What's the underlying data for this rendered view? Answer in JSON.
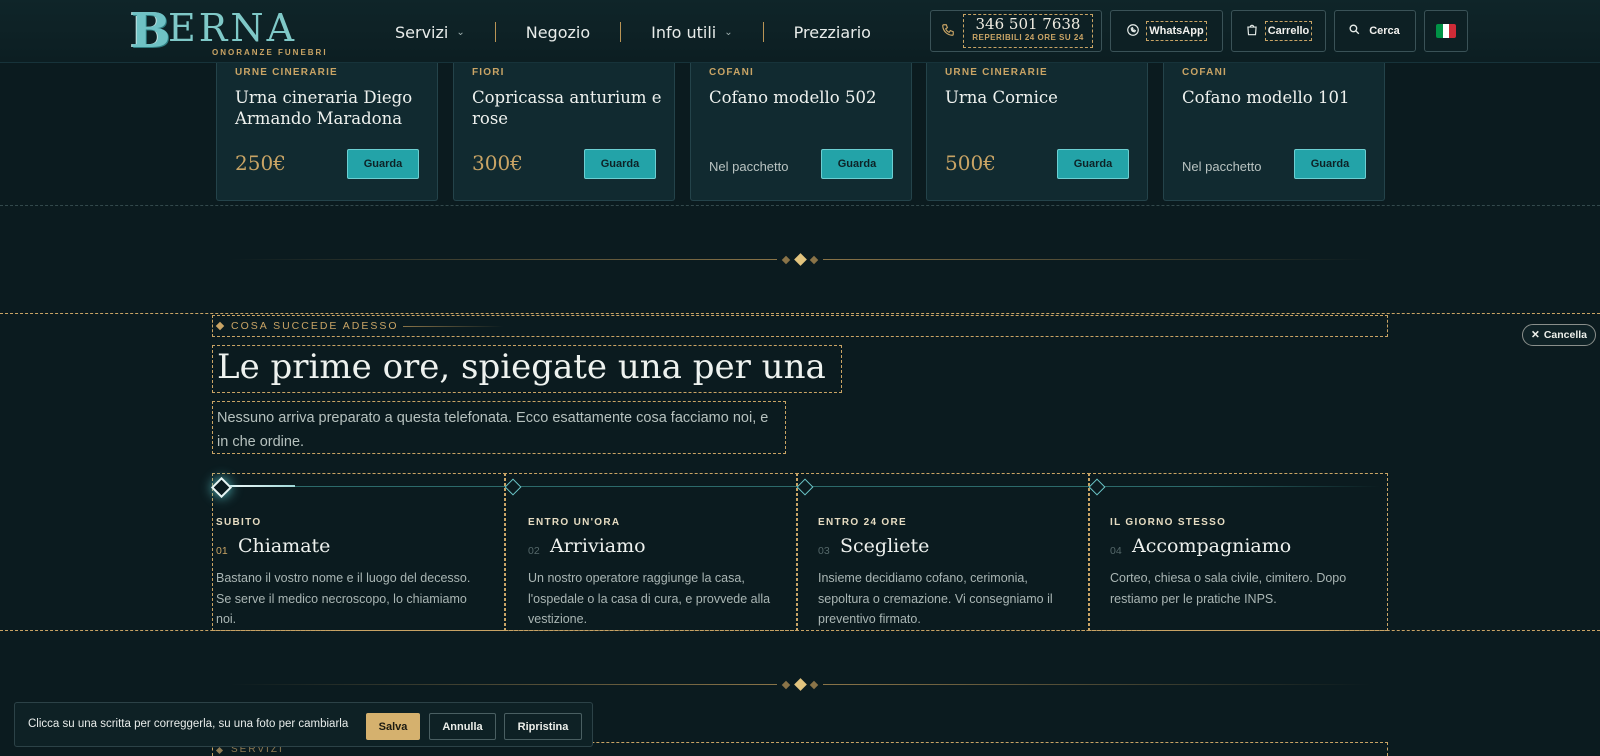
{
  "header": {
    "logo_letter": "B",
    "logo_word": "ERNA",
    "logo_subtitle": "ONORANZE FUNEBRI",
    "nav": [
      {
        "label": "Servizi",
        "has_dropdown": true
      },
      {
        "label": "Negozio",
        "has_dropdown": false
      },
      {
        "label": "Info utili",
        "has_dropdown": true
      },
      {
        "label": "Prezziario",
        "has_dropdown": false
      }
    ],
    "phone": {
      "number": "346 501 7638",
      "note": "REPERIBILI 24 ORE SU 24",
      "icon": "phone-icon"
    },
    "whatsapp_label": "WhatsApp",
    "cart_label": "Carrello",
    "search_label": "Cerca",
    "flag_colors": [
      "#009246",
      "#ffffff",
      "#ce2b37"
    ]
  },
  "products": [
    {
      "category": "URNE CINERARIE",
      "title": "Urna cineraria Diego Armando Maradona",
      "price": "250€",
      "note": "",
      "button": "Guarda"
    },
    {
      "category": "FIORI",
      "title": "Copricassa anturium e rose",
      "price": "300€",
      "note": "",
      "button": "Guarda"
    },
    {
      "category": "COFANI",
      "title": "Cofano modello 502",
      "price": "",
      "note": "Nel pacchetto",
      "button": "Guarda"
    },
    {
      "category": "URNE CINERARIE",
      "title": "Urna Cornice",
      "price": "500€",
      "note": "",
      "button": "Guarda"
    },
    {
      "category": "COFANI",
      "title": "Cofano modello 101",
      "price": "",
      "note": "Nel pacchetto",
      "button": "Guarda"
    }
  ],
  "section": {
    "eyebrow": "COSA SUCCEDE ADESSO",
    "cancel_label": "Cancella",
    "headline": "Le prime ore, spiegate una per una",
    "lead": "Nessuno arriva preparato a questa telefonata. Ecco esattamente cosa facciamo noi, e in che ordine.",
    "steps": [
      {
        "when": "SUBITO",
        "num": "01",
        "title": "Chiamate",
        "desc": "Bastano il vostro nome e il luogo del decesso. Se serve il medico necroscopo, lo chiamiamo noi.",
        "active": true
      },
      {
        "when": "ENTRO UN'ORA",
        "num": "02",
        "title": "Arriviamo",
        "desc": "Un nostro operatore raggiunge la casa, l'ospedale o la casa di cura, e provvede alla vestizione.",
        "active": false
      },
      {
        "when": "ENTRO 24 ORE",
        "num": "03",
        "title": "Scegliete",
        "desc": "Insieme decidiamo cofano, cerimonia, sepoltura o cremazione. Vi consegniamo il preventivo firmato.",
        "active": false
      },
      {
        "when": "IL GIORNO STESSO",
        "num": "04",
        "title": "Accompagniamo",
        "desc": "Corteo, chiesa o sala civile, cimitero. Dopo restiamo per le pratiche INPS.",
        "active": false
      }
    ]
  },
  "next_section_eyebrow": "SERVIZI",
  "editbar": {
    "hint": "Clicca su una scritta per correggerla, su una foto per cambiarla",
    "save": "Salva",
    "cancel": "Annulla",
    "reset": "Ripristina"
  }
}
